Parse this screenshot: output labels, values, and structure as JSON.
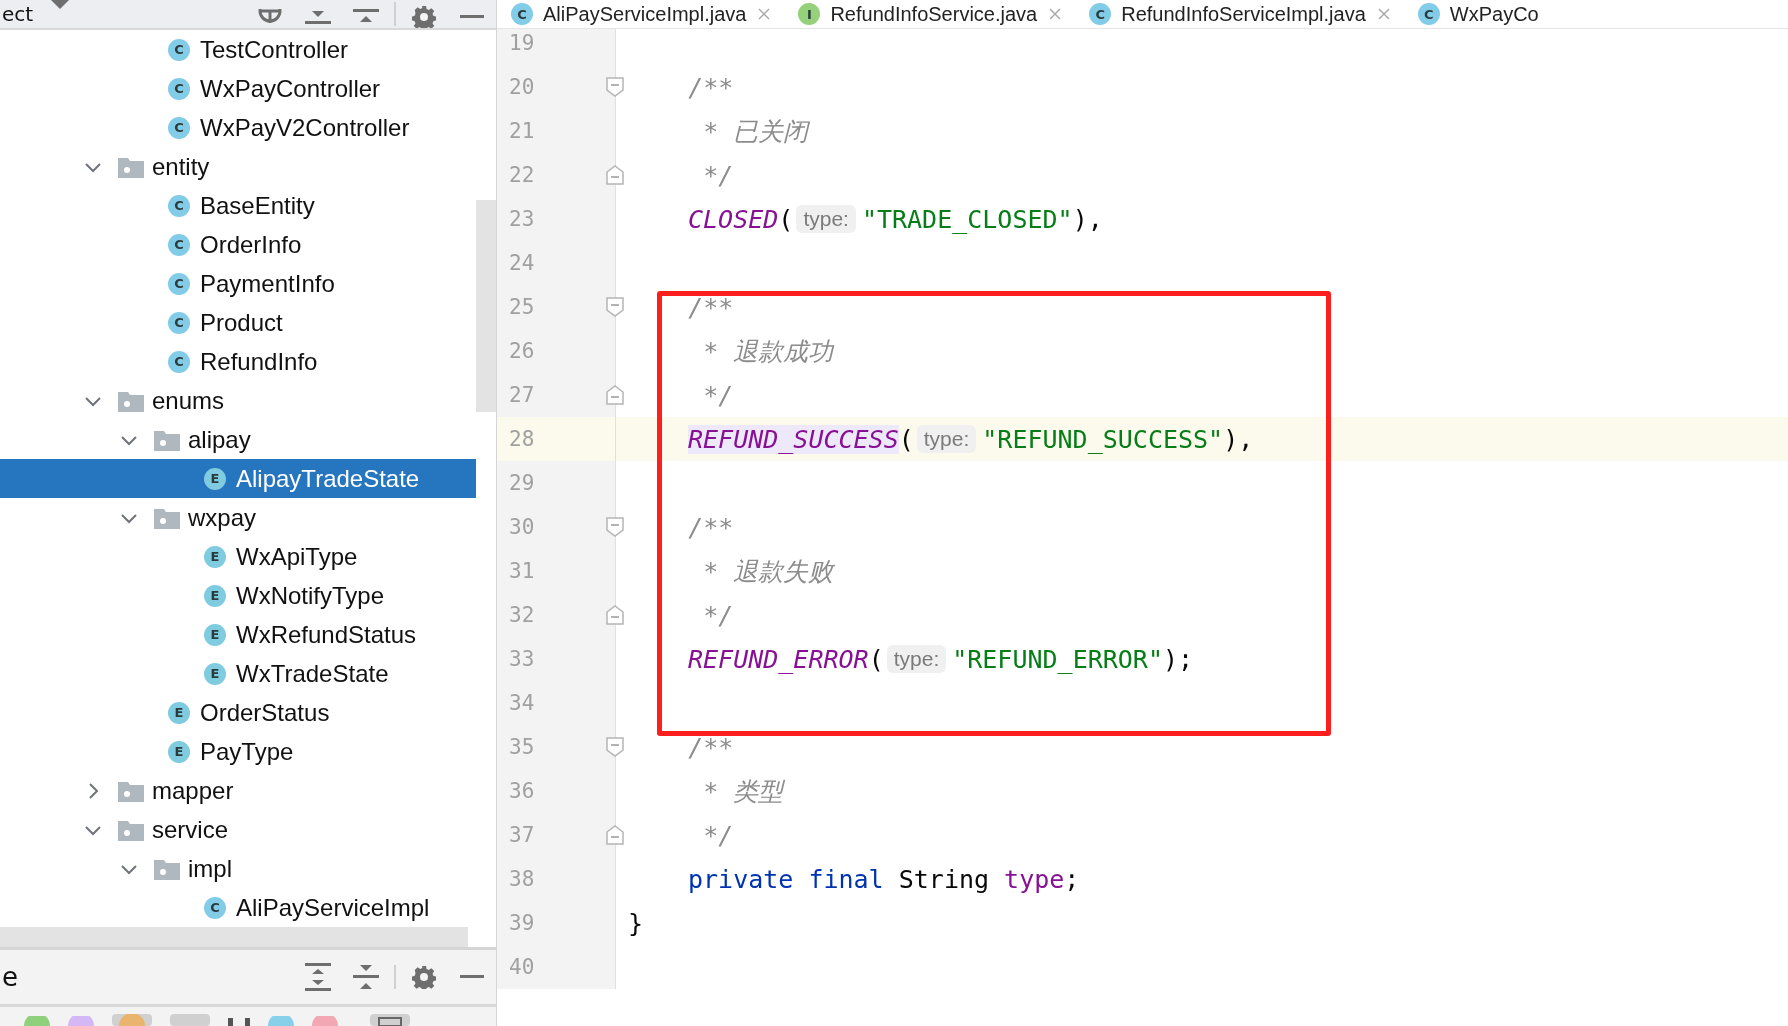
{
  "project_panel": {
    "title": "ect",
    "continued_items": [
      {
        "label": "TestController",
        "kind": "class",
        "icon_letter": "C",
        "selected": false
      },
      {
        "label": "WxPayController",
        "kind": "class",
        "icon_letter": "C",
        "selected": false
      },
      {
        "label": "WxPayV2Controller",
        "kind": "class",
        "icon_letter": "C",
        "selected": false
      }
    ],
    "items": [
      {
        "label": "entity",
        "kind": "folder",
        "expanded": true,
        "selected": false,
        "children": [
          {
            "label": "BaseEntity",
            "kind": "class",
            "icon_letter": "C",
            "selected": false
          },
          {
            "label": "OrderInfo",
            "kind": "class",
            "icon_letter": "C",
            "selected": false
          },
          {
            "label": "PaymentInfo",
            "kind": "class",
            "icon_letter": "C",
            "selected": false
          },
          {
            "label": "Product",
            "kind": "class",
            "icon_letter": "C",
            "selected": false
          },
          {
            "label": "RefundInfo",
            "kind": "class",
            "icon_letter": "C",
            "selected": false
          }
        ]
      },
      {
        "label": "enums",
        "kind": "folder",
        "expanded": true,
        "selected": false,
        "children": [
          {
            "label": "alipay",
            "kind": "folder",
            "expanded": true,
            "selected": false,
            "children": [
              {
                "label": "AlipayTradeState",
                "kind": "enum",
                "icon_letter": "E",
                "selected": true
              }
            ]
          },
          {
            "label": "wxpay",
            "kind": "folder",
            "expanded": true,
            "selected": false,
            "children": [
              {
                "label": "WxApiType",
                "kind": "enum",
                "icon_letter": "E",
                "selected": false
              },
              {
                "label": "WxNotifyType",
                "kind": "enum",
                "icon_letter": "E",
                "selected": false
              },
              {
                "label": "WxRefundStatus",
                "kind": "enum",
                "icon_letter": "E",
                "selected": false
              },
              {
                "label": "WxTradeState",
                "kind": "enum",
                "icon_letter": "E",
                "selected": false
              }
            ]
          },
          {
            "label": "OrderStatus",
            "kind": "enum",
            "icon_letter": "E",
            "selected": false
          },
          {
            "label": "PayType",
            "kind": "enum",
            "icon_letter": "E",
            "selected": false
          }
        ]
      },
      {
        "label": "mapper",
        "kind": "folder",
        "expanded": false,
        "selected": false
      },
      {
        "label": "service",
        "kind": "folder",
        "expanded": true,
        "selected": false,
        "children": [
          {
            "label": "impl",
            "kind": "folder",
            "expanded": true,
            "selected": false,
            "children": [
              {
                "label": "AliPayServiceImpl",
                "kind": "class",
                "icon_letter": "C",
                "selected": false
              }
            ]
          }
        ]
      }
    ]
  },
  "bottom_panel": {
    "title": "e"
  },
  "editor_tabs": [
    {
      "label": "AliPayServiceImpl.java",
      "kind": "class",
      "icon_letter": "C",
      "selected": false,
      "closable": true
    },
    {
      "label": "RefundInfoService.java",
      "kind": "interface",
      "icon_letter": "I",
      "selected": false,
      "closable": true
    },
    {
      "label": "RefundInfoServiceImpl.java",
      "kind": "class",
      "icon_letter": "C",
      "selected": false,
      "closable": true
    },
    {
      "label": "WxPayCo",
      "kind": "class",
      "icon_letter": "C",
      "selected": false,
      "closable": false
    }
  ],
  "editor": {
    "lines": [
      {
        "number": "19",
        "current": false,
        "fold_start": false,
        "fold_end": false
      },
      {
        "number": "20",
        "current": false,
        "fold_start": true,
        "fold_end": false,
        "indented": false,
        "tokens": [
          {
            "text": "    /**",
            "kind": "comment"
          }
        ]
      },
      {
        "number": "21",
        "current": false,
        "fold_start": false,
        "fold_end": false,
        "indented": false,
        "tokens": [
          {
            "text": "     * 已关闭",
            "kind": "comment"
          }
        ]
      },
      {
        "number": "22",
        "current": false,
        "fold_start": false,
        "fold_end": true,
        "indented": false,
        "tokens": [
          {
            "text": "     */",
            "kind": "comment"
          }
        ]
      },
      {
        "number": "23",
        "current": false,
        "fold_start": false,
        "fold_end": false,
        "indented": true,
        "tokens": [
          {
            "text": "CLOSED",
            "kind": "constant",
            "highlighted": false
          },
          {
            "text": "(",
            "kind": "plain"
          },
          {
            "text": "type:",
            "kind": "hint"
          },
          {
            "text": "\"TRADE_CLOSED\"",
            "kind": "string"
          },
          {
            "text": "),",
            "kind": "plain"
          }
        ]
      },
      {
        "number": "24",
        "current": false,
        "fold_start": false,
        "fold_end": false
      },
      {
        "number": "25",
        "current": false,
        "fold_start": true,
        "fold_end": false,
        "indented": false,
        "tokens": [
          {
            "text": "    /**",
            "kind": "comment"
          }
        ]
      },
      {
        "number": "26",
        "current": false,
        "fold_start": false,
        "fold_end": false,
        "indented": false,
        "tokens": [
          {
            "text": "     * 退款成功",
            "kind": "comment"
          }
        ]
      },
      {
        "number": "27",
        "current": false,
        "fold_start": false,
        "fold_end": true,
        "indented": false,
        "tokens": [
          {
            "text": "     */",
            "kind": "comment"
          }
        ]
      },
      {
        "number": "28",
        "current": true,
        "fold_start": false,
        "fold_end": false,
        "indented": true,
        "tokens": [
          {
            "text": "REFUND_SUCCESS",
            "kind": "constant",
            "highlighted": true
          },
          {
            "text": "(",
            "kind": "plain"
          },
          {
            "text": "type:",
            "kind": "hint"
          },
          {
            "text": "\"REFUND_SUCCESS\"",
            "kind": "string"
          },
          {
            "text": "),",
            "kind": "plain"
          }
        ]
      },
      {
        "number": "29",
        "current": false,
        "fold_start": false,
        "fold_end": false
      },
      {
        "number": "30",
        "current": false,
        "fold_start": true,
        "fold_end": false,
        "indented": false,
        "tokens": [
          {
            "text": "    /**",
            "kind": "comment"
          }
        ]
      },
      {
        "number": "31",
        "current": false,
        "fold_start": false,
        "fold_end": false,
        "indented": false,
        "tokens": [
          {
            "text": "     * 退款失败",
            "kind": "comment"
          }
        ]
      },
      {
        "number": "32",
        "current": false,
        "fold_start": false,
        "fold_end": true,
        "indented": false,
        "tokens": [
          {
            "text": "     */",
            "kind": "comment"
          }
        ]
      },
      {
        "number": "33",
        "current": false,
        "fold_start": false,
        "fold_end": false,
        "indented": true,
        "tokens": [
          {
            "text": "REFUND_ERROR",
            "kind": "constant",
            "highlighted": false
          },
          {
            "text": "(",
            "kind": "plain"
          },
          {
            "text": "type:",
            "kind": "hint"
          },
          {
            "text": "\"REFUND_ERROR\"",
            "kind": "string"
          },
          {
            "text": ");",
            "kind": "plain"
          }
        ]
      },
      {
        "number": "34",
        "current": false,
        "fold_start": false,
        "fold_end": false
      },
      {
        "number": "35",
        "current": false,
        "fold_start": true,
        "fold_end": false,
        "indented": false,
        "tokens": [
          {
            "text": "    /**",
            "kind": "comment"
          }
        ]
      },
      {
        "number": "36",
        "current": false,
        "fold_start": false,
        "fold_end": false,
        "indented": false,
        "tokens": [
          {
            "text": "     * 类型",
            "kind": "comment"
          }
        ]
      },
      {
        "number": "37",
        "current": false,
        "fold_start": false,
        "fold_end": true,
        "indented": false,
        "tokens": [
          {
            "text": "     */",
            "kind": "comment"
          }
        ]
      },
      {
        "number": "38",
        "current": false,
        "fold_start": false,
        "fold_end": false,
        "indented": true,
        "tokens": [
          {
            "text": "private final",
            "kind": "keyword"
          },
          {
            "text": " String ",
            "kind": "plain"
          },
          {
            "text": "type",
            "kind": "field"
          },
          {
            "text": ";",
            "kind": "plain"
          }
        ]
      },
      {
        "number": "39",
        "current": false,
        "fold_start": false,
        "fold_end": false,
        "indented": false,
        "tokens": [
          {
            "text": "}",
            "kind": "plain"
          }
        ]
      },
      {
        "number": "40",
        "current": false,
        "fold_start": false,
        "fold_end": false
      }
    ]
  }
}
